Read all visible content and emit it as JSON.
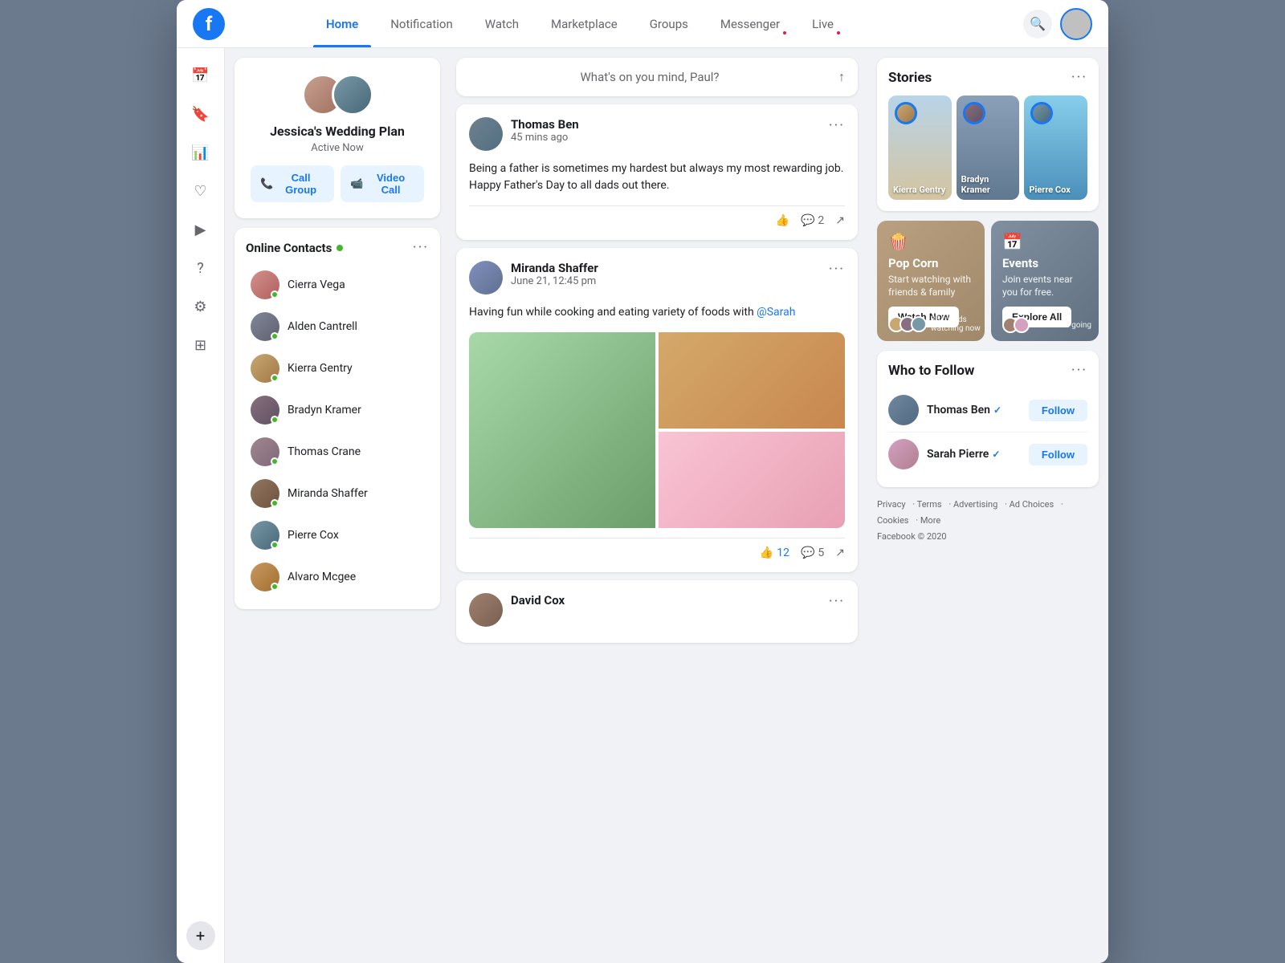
{
  "nav": {
    "logo": "f",
    "links": [
      {
        "id": "home",
        "label": "Home",
        "active": true
      },
      {
        "id": "notification",
        "label": "Notification"
      },
      {
        "id": "watch",
        "label": "Watch"
      },
      {
        "id": "marketplace",
        "label": "Marketplace"
      },
      {
        "id": "groups",
        "label": "Groups"
      },
      {
        "id": "messenger",
        "label": "Messenger",
        "dot": true
      },
      {
        "id": "live",
        "label": "Live",
        "dot": true
      }
    ]
  },
  "left_icons": [
    "calendar",
    "bookmark",
    "chart",
    "heart",
    "video",
    "help",
    "settings",
    "grid"
  ],
  "wedding_card": {
    "title": "Jessica's Wedding Plan",
    "subtitle": "Active Now",
    "call_group": "Call Group",
    "video_call": "Video Call"
  },
  "contacts": {
    "title": "Online Contacts",
    "items": [
      {
        "name": "Cierra Vega",
        "av": "av-cierra"
      },
      {
        "name": "Alden Cantrell",
        "av": "av-alden"
      },
      {
        "name": "Kierra Gentry",
        "av": "av-kierra"
      },
      {
        "name": "Bradyn Kramer",
        "av": "av-bradyn"
      },
      {
        "name": "Thomas Crane",
        "av": "av-thomas-c"
      },
      {
        "name": "Miranda Shaffer",
        "av": "av-miranda"
      },
      {
        "name": "Pierre Cox",
        "av": "av-pierre"
      },
      {
        "name": "Alvaro Mcgee",
        "av": "av-alvaro"
      }
    ]
  },
  "feed": {
    "mind_placeholder": "What's on you mind, Paul?",
    "posts": [
      {
        "id": "post1",
        "author": "Thomas Ben",
        "time": "45 mins ago",
        "text_line1": "Being a father is sometimes my hardest but always my most rewarding job.",
        "text_line2": "Happy Father's Day to all dads out there.",
        "likes": "",
        "comments": "2",
        "av": "av-thomas-post"
      },
      {
        "id": "post2",
        "author": "Miranda Shaffer",
        "time": "June 21, 12:45 pm",
        "text_pre": "Having fun while cooking and eating variety of foods with ",
        "mention": "@Sarah",
        "likes": "12",
        "comments": "5",
        "av": "av-miranda-post"
      },
      {
        "id": "post3",
        "author": "David Cox",
        "time": "",
        "av": "av-david"
      }
    ]
  },
  "stories": {
    "title": "Stories",
    "items": [
      {
        "name": "Kierra Gentry",
        "card_class": "dog"
      },
      {
        "name": "Bradyn Kramer",
        "card_class": "soldier"
      },
      {
        "name": "Pierre Cox",
        "card_class": "temple"
      }
    ]
  },
  "promo": {
    "popcorn": {
      "icon": "🍿",
      "title": "Pop Corn",
      "text": "Start watching with friends & family",
      "btn": "Watch Now",
      "friends": "35 friends watching now"
    },
    "events": {
      "icon": "📅",
      "title": "Events",
      "text": "Join events near you for free.",
      "btn": "Explore All",
      "friends": "14 friends going"
    }
  },
  "who_to_follow": {
    "title": "Who to Follow",
    "items": [
      {
        "name": "Thomas Ben",
        "verified": true,
        "btn": "Follow",
        "av": "av-thomas-b"
      },
      {
        "name": "Sarah Pierre",
        "verified": true,
        "btn": "Follow",
        "av": "av-sarah"
      }
    ]
  },
  "footer": {
    "links": [
      "Privacy",
      "Terms",
      "Advertising",
      "Ad Choices",
      "Cookies",
      "More"
    ],
    "copyright": "Facebook © 2020"
  }
}
